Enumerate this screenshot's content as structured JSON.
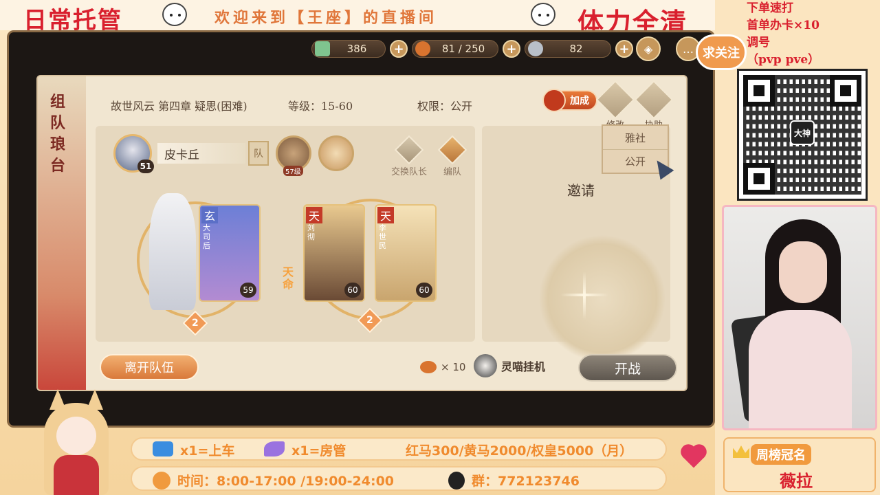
{
  "overlay": {
    "title_left": "日常托管",
    "welcome": "欢迎来到【王座】的直播间",
    "title_right": "体力全清",
    "follow": "求关注",
    "promo_lines": [
      "下单速打",
      "首单办卡×10",
      "调号",
      "（pvp   pve）"
    ],
    "qr_logo": "大神",
    "weekly_title": "周榜冠名",
    "weekly_name": "薇拉",
    "info_board": "x1=上车",
    "info_admin": "x1=房管",
    "info_prices": "红马300/黄马2000/权皇5000（月）",
    "info_time": "时间：8:00-17:00 /19:00-24:00",
    "info_group": "群：772123746"
  },
  "game": {
    "resources": [
      {
        "icon": "jade-icon",
        "value": "386",
        "color": "#7fc48f"
      },
      {
        "icon": "stamina-food-icon",
        "value": "81 / 250",
        "color": "#d9742f"
      },
      {
        "icon": "ticket-icon",
        "value": "82",
        "color": "#b9c0c9"
      }
    ],
    "dialog": {
      "side_title": "组队琅台",
      "chapter": "故世风云  第四章  疑思(困难)",
      "level": "等级：15-60",
      "permission": "权限：公开",
      "join_label": "加成",
      "modify_label": "修改",
      "assist_label": "协助",
      "dropdown_options": [
        "雅社",
        "公开"
      ],
      "player": {
        "name": "皮卡丘",
        "level": "51",
        "team_tag": "队"
      },
      "extra_badge": "57级",
      "swap_leader": "交换队长",
      "formation": "编队",
      "cards": [
        {
          "tier": "玄",
          "name": "大司后",
          "level": "59"
        },
        {
          "tier": "天",
          "name": "刘彻",
          "level": "60"
        },
        {
          "tier": "天",
          "name": "李世民",
          "level": "60"
        }
      ],
      "fate_label": "天命",
      "star_left": "2",
      "star_right": "2",
      "invite": "邀请",
      "leave": "离开队伍",
      "cost": "× 10",
      "auto_label": "灵喵挂机",
      "fight": "开战"
    }
  }
}
